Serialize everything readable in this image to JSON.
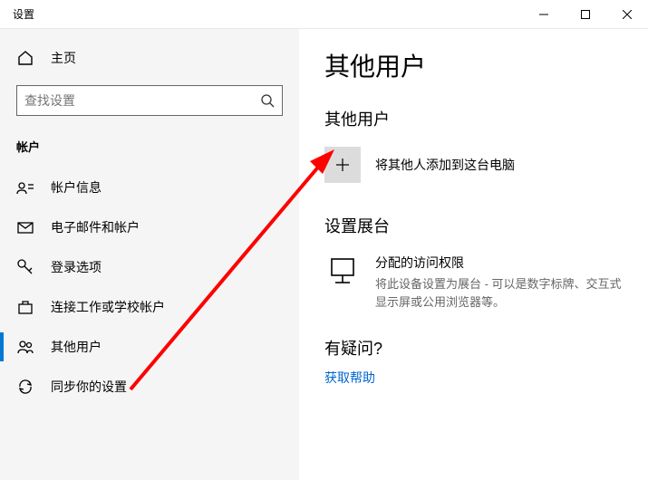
{
  "window": {
    "title": "设置"
  },
  "sidebar": {
    "home": "主页",
    "search_placeholder": "查找设置",
    "section": "帐户",
    "items": [
      {
        "label": "帐户信息"
      },
      {
        "label": "电子邮件和帐户"
      },
      {
        "label": "登录选项"
      },
      {
        "label": "连接工作或学校帐户"
      },
      {
        "label": "其他用户"
      },
      {
        "label": "同步你的设置"
      }
    ]
  },
  "main": {
    "title": "其他用户",
    "sub1": "其他用户",
    "add_user": "将其他人添加到这台电脑",
    "sub2": "设置展台",
    "kiosk_title": "分配的访问权限",
    "kiosk_desc": "将此设备设置为展台 - 可以是数字标牌、交互式显示屏或公用浏览器等。",
    "help_title": "有疑问?",
    "help_link": "获取帮助"
  }
}
